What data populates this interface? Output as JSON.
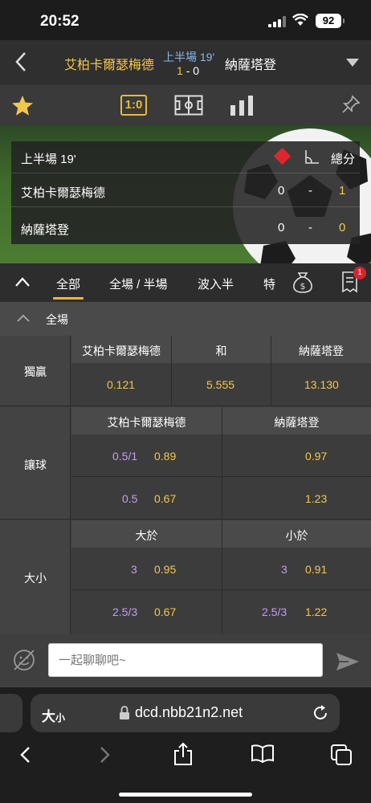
{
  "status_bar": {
    "time": "20:52",
    "battery": "92"
  },
  "header": {
    "home_team": "艾柏卡爾瑟梅德",
    "period": "上半場 19'",
    "score_home": "1",
    "score_sep": "-",
    "score_away": "0",
    "away_team": "納薩塔登"
  },
  "toolbar": {
    "score_label": "1:0"
  },
  "scoreboard": {
    "period": "上半場 19'",
    "total_label": "總分",
    "rows": [
      {
        "team": "艾柏卡爾瑟梅德",
        "red": "0",
        "sep": "-",
        "total": "1"
      },
      {
        "team": "納薩塔登",
        "red": "0",
        "sep": "-",
        "total": "0"
      }
    ]
  },
  "tabs": {
    "items": [
      "全部",
      "全場 / 半場",
      "波入半",
      "特"
    ],
    "active": "全部",
    "badge": "1"
  },
  "section": {
    "title": "全場"
  },
  "markets": {
    "winner": {
      "name": "獨贏",
      "headers": [
        "艾柏卡爾瑟梅德",
        "和",
        "納薩塔登"
      ],
      "odds": [
        "0.121",
        "5.555",
        "13.130"
      ]
    },
    "handicap": {
      "name": "讓球",
      "headers": [
        "艾柏卡爾瑟梅德",
        "納薩塔登"
      ],
      "rows": [
        {
          "line": "0.5/1",
          "home": "0.89",
          "away": "0.97"
        },
        {
          "line": "0.5",
          "home": "0.67",
          "away": "1.23"
        }
      ]
    },
    "totals": {
      "name": "大小",
      "headers": [
        "大於",
        "小於"
      ],
      "rows": [
        {
          "over_line": "3",
          "over": "0.95",
          "under_line": "3",
          "under": "0.91"
        },
        {
          "over_line": "2.5/3",
          "over": "0.67",
          "under_line": "2.5/3",
          "under": "1.22"
        }
      ]
    }
  },
  "chat": {
    "placeholder": "一起聊聊吧~"
  },
  "browser": {
    "text_size": "大",
    "text_size_small": "小",
    "url": "dcd.nbb21n2.net"
  },
  "colors": {
    "accent": "#f3c74b",
    "line": "#c79cf0",
    "red_card": "#e0262d",
    "badge": "#d8232f"
  }
}
